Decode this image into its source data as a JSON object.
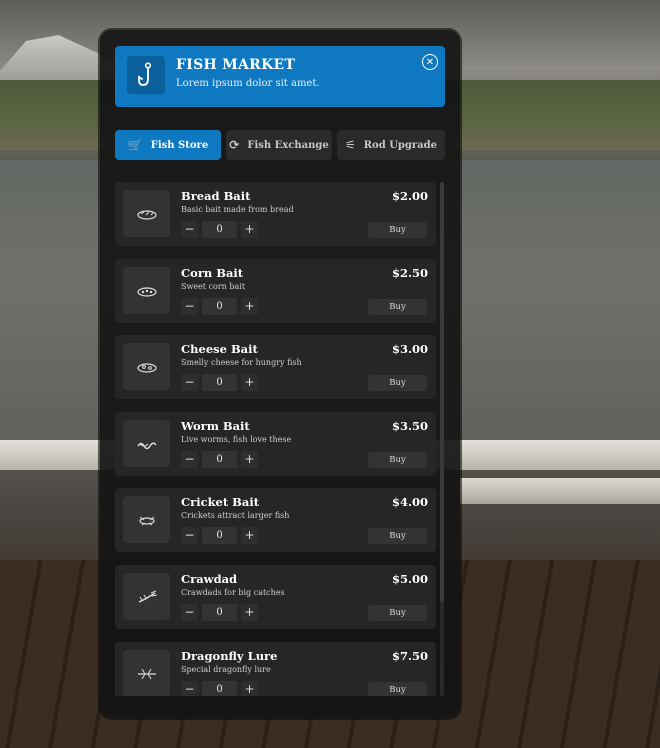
{
  "header": {
    "title": "FISH MARKET",
    "subtitle": "Lorem ipsum dolor sit amet.",
    "logo_icon": "fishing-hook-icon",
    "close_icon": "close-icon",
    "close_symbol": "✕",
    "accent": "#0e78c1"
  },
  "tabs": [
    {
      "label": "Fish Store",
      "icon": "cart-icon",
      "symbol": "🛒",
      "active": true
    },
    {
      "label": "Fish Exchange",
      "icon": "exchange-icon",
      "symbol": "⟳",
      "active": false
    },
    {
      "label": "Rod Upgrade",
      "icon": "fishing-rod-icon",
      "symbol": "⚟",
      "active": false
    }
  ],
  "items": [
    {
      "name": "Bread Bait",
      "description": "Basic bait made from bread",
      "price": "$2.00",
      "quantity": "0",
      "buy_label": "Buy",
      "icon": "bread-bait-icon"
    },
    {
      "name": "Corn Bait",
      "description": "Sweet corn bait",
      "price": "$2.50",
      "quantity": "0",
      "buy_label": "Buy",
      "icon": "corn-bait-icon"
    },
    {
      "name": "Cheese Bait",
      "description": "Smelly cheese for hungry fish",
      "price": "$3.00",
      "quantity": "0",
      "buy_label": "Buy",
      "icon": "cheese-bait-icon"
    },
    {
      "name": "Worm Bait",
      "description": "Live worms, fish love these",
      "price": "$3.50",
      "quantity": "0",
      "buy_label": "Buy",
      "icon": "worm-bait-icon"
    },
    {
      "name": "Cricket Bait",
      "description": "Crickets attract larger fish",
      "price": "$4.00",
      "quantity": "0",
      "buy_label": "Buy",
      "icon": "cricket-bait-icon"
    },
    {
      "name": "Crawdad",
      "description": "Crawdads for big catches",
      "price": "$5.00",
      "quantity": "0",
      "buy_label": "Buy",
      "icon": "crawdad-icon"
    },
    {
      "name": "Dragonfly Lure",
      "description": "Special dragonfly lure",
      "price": "$7.50",
      "quantity": "0",
      "buy_label": "Buy",
      "icon": "dragonfly-lure-icon"
    }
  ],
  "stepper": {
    "minus": "−",
    "plus": "+"
  }
}
